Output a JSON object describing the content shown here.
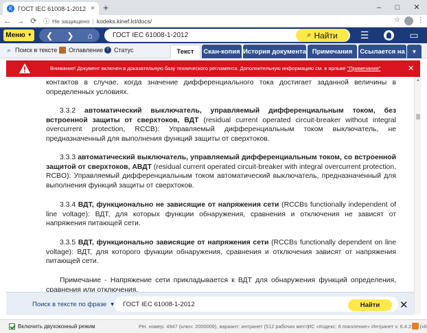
{
  "browser": {
    "tab_title": "ГОСТ IEC 61008-1-2012 Выключат...",
    "tab_close": "×",
    "new_tab": "+",
    "security_label": "Не защищено",
    "url": "kodeks.kinef.lcl/docs/",
    "window_controls": [
      "–",
      "□",
      "✕"
    ]
  },
  "header": {
    "menu_label": "Меню",
    "search_query": "ГОСТ IEC 61008-1-2012",
    "find_label": "Найти"
  },
  "toolbar": {
    "items": [
      {
        "label": "Поиск в тексте",
        "icon": "search-icon"
      },
      {
        "label": "Оглавление",
        "icon": "book-icon"
      },
      {
        "label": "Статус",
        "icon": "status-icon"
      }
    ],
    "tabs": [
      {
        "label": "Текст",
        "active": true
      },
      {
        "label": "Скан-копия",
        "active": false
      },
      {
        "label": "История документа",
        "active": false
      },
      {
        "label": "Примечания",
        "active": false
      },
      {
        "label": "Ссылается на",
        "active": false
      }
    ]
  },
  "warning": {
    "text": "Внимание! Документ включен в доказательную базу технического регламента. Дополнительную информацию см. в ярлыке",
    "link": "\"Примечания\""
  },
  "document": {
    "p0": "контактов в случае, когда значение дифференциального тока достигает заданной величины в определенных условиях.",
    "p1_num": "3.3.2",
    "p1_term": "автоматический выключатель, управляемый дифференциальным током, без встроенной защиты от сверхтоков, ВДТ",
    "p1_rest": "(residual current operated circuit-breaker without integral overcurrent protection, RCCB): Управляемый дифференциальным током выключатель, не предназначенный для выполнения функций защиты от сверхтоков.",
    "p2_num": "3.3.3",
    "p2_term": "автоматический выключатель, управляемый дифференциальным током, со встроенной защитой от сверхтоков, АВДТ",
    "p2_rest": "(residual current operated circuit-breaker with integral overcurrent protection, RCBO): Управляемый дифференциальным током автоматический выключатель, предназначенный для выполнения функций защиты от сверхтоков.",
    "p3_num": "3.3.4",
    "p3_term": "ВДТ, функционально не зависящие от напряжения сети",
    "p3_rest": "(RCCBs functionally independent of line voltage): ВДТ, для которых функции обнаружения, сравнения и отключения не зависят от напряжения питающей сети.",
    "p4_num": "3.3.5",
    "p4_term": "ВДТ, функционально зависящие от напряжения сети",
    "p4_rest": "(RCCBs functionally dependent on line voltage): ВДТ, для которого функции обнаружения, сравнения и отключения зависят от напряжения питающей сети.",
    "p5": "Примечание - Напряжение сети прикладывается к ВДТ для обнаружения функций определения, сравнения или отключения."
  },
  "bottom_search": {
    "label": "Поиск в тексте по фразе",
    "dropdown": "▾",
    "query": "ГОСТ IEC 61008-1-2012",
    "find_label": "Найти",
    "close": "✕"
  },
  "status": {
    "dual_mode": "Включить двухоконный режим",
    "reg_info": "Рег. номер: 4947 (ключ: 2000009), вариант: интранет (512 рабочих мест)",
    "version_info": "ИС «Кодекс: 6 поколение» Интранет v. 6.4.2.73 (x64)"
  }
}
